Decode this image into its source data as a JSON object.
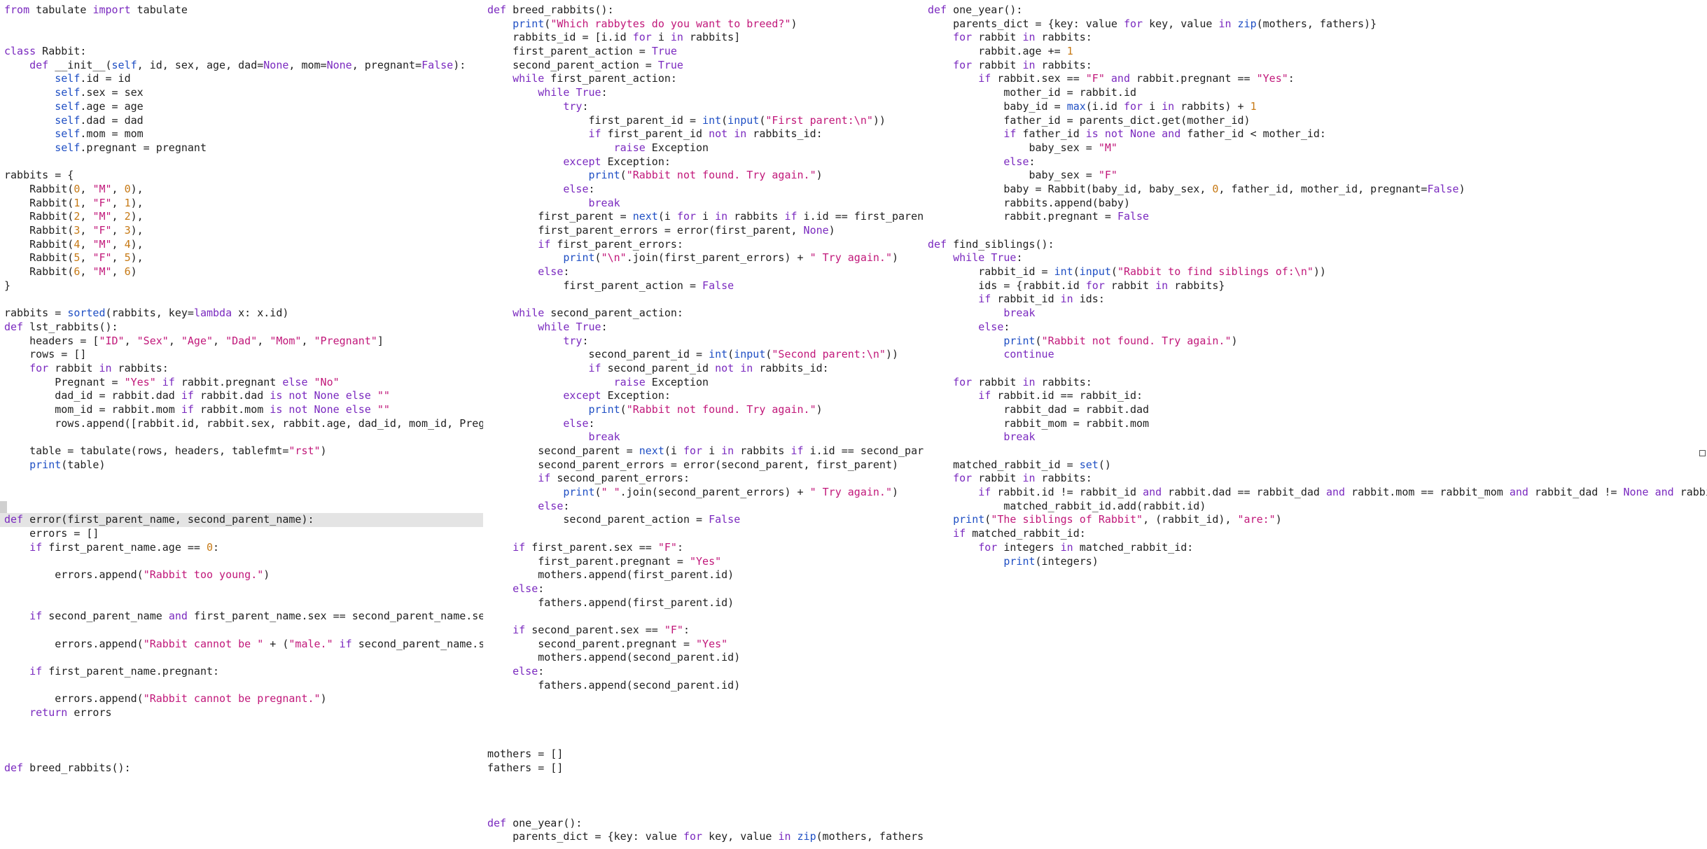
{
  "editor": {
    "highlighted_line": "def error(first_parent_name, second_parent_name):",
    "colors": {
      "keyword": "#7a29bf",
      "builtin": "#1f4fc4",
      "string": "#c1187a",
      "number": "#c77a16",
      "text": "#1f1f1f",
      "highlight": "#e4e4e4"
    },
    "panes": [
      {
        "id": "left",
        "lines": [
          "from tabulate import tabulate",
          "",
          "",
          "class Rabbit:",
          "    def __init__(self, id, sex, age, dad=None, mom=None, pregnant=False):",
          "        self.id = id",
          "        self.sex = sex",
          "        self.age = age",
          "        self.dad = dad",
          "        self.mom = mom",
          "        self.pregnant = pregnant",
          "",
          "rabbits = {",
          "    Rabbit(0, \"M\", 0),",
          "    Rabbit(1, \"F\", 1),",
          "    Rabbit(2, \"M\", 2),",
          "    Rabbit(3, \"F\", 3),",
          "    Rabbit(4, \"M\", 4),",
          "    Rabbit(5, \"F\", 5),",
          "    Rabbit(6, \"M\", 6)",
          "}",
          "",
          "rabbits = sorted(rabbits, key=lambda x: x.id)",
          "def lst_rabbits():",
          "    headers = [\"ID\", \"Sex\", \"Age\", \"Dad\", \"Mom\", \"Pregnant\"]",
          "    rows = []",
          "    for rabbit in rabbits:",
          "        Pregnant = \"Yes\" if rabbit.pregnant else \"No\"",
          "        dad_id = rabbit.dad if rabbit.dad is not None else \"\"",
          "        mom_id = rabbit.mom if rabbit.mom is not None else \"\"",
          "        rows.append([rabbit.id, rabbit.sex, rabbit.age, dad_id, mom_id, Pregnant])",
          "",
          "    table = tabulate(rows, headers, tablefmt=\"rst\")",
          "    print(table)",
          "",
          "",
          "",
          "def error(first_parent_name, second_parent_name):",
          "    errors = []",
          "    if first_parent_name.age == 0:",
          "",
          "        errors.append(\"Rabbit too young.\")",
          "",
          "",
          "    if second_parent_name and first_parent_name.sex == second_parent_name.sex:",
          "",
          "        errors.append(\"Rabbit cannot be \" + (\"male.\" if second_parent_name.sex ==",
          "",
          "    if first_parent_name.pregnant:",
          "",
          "        errors.append(\"Rabbit cannot be pregnant.\")",
          "    return errors",
          "",
          "",
          "",
          "def breed_rabbits():"
        ]
      },
      {
        "id": "mid",
        "lines": [
          "def breed_rabbits():",
          "    print(\"Which rabbytes do you want to breed?\")",
          "    rabbits_id = [i.id for i in rabbits]",
          "    first_parent_action = True",
          "    second_parent_action = True",
          "    while first_parent_action:",
          "        while True:",
          "            try:",
          "                first_parent_id = int(input(\"First parent:\\n\"))",
          "                if first_parent_id not in rabbits_id:",
          "                    raise Exception",
          "            except Exception:",
          "                print(\"Rabbit not found. Try again.\")",
          "            else:",
          "                break",
          "        first_parent = next(i for i in rabbits if i.id == first_parent_id)",
          "        first_parent_errors = error(first_parent, None)",
          "        if first_parent_errors:",
          "            print(\"\\n\".join(first_parent_errors) + \" Try again.\")",
          "        else:",
          "            first_parent_action = False",
          "",
          "    while second_parent_action:",
          "        while True:",
          "            try:",
          "                second_parent_id = int(input(\"Second parent:\\n\"))",
          "                if second_parent_id not in rabbits_id:",
          "                    raise Exception",
          "            except Exception:",
          "                print(\"Rabbit not found. Try again.\")",
          "            else:",
          "                break",
          "        second_parent = next(i for i in rabbits if i.id == second_parent_i",
          "        second_parent_errors = error(second_parent, first_parent)",
          "        if second_parent_errors:",
          "            print(\" \".join(second_parent_errors) + \" Try again.\")",
          "        else:",
          "            second_parent_action = False",
          "",
          "    if first_parent.sex == \"F\":",
          "        first_parent.pregnant = \"Yes\"",
          "        mothers.append(first_parent.id)",
          "    else:",
          "        fathers.append(first_parent.id)",
          "",
          "    if second_parent.sex == \"F\":",
          "        second_parent.pregnant = \"Yes\"",
          "        mothers.append(second_parent.id)",
          "    else:",
          "        fathers.append(second_parent.id)",
          "",
          "",
          "",
          "",
          "mothers = []",
          "fathers = []",
          "",
          "",
          "",
          "def one_year():",
          "    parents_dict = {key: value for key, value in zip(mothers, fathers)}"
        ]
      },
      {
        "id": "right",
        "lines": [
          "def one_year():",
          "    parents_dict = {key: value for key, value in zip(mothers, fathers)}",
          "    for rabbit in rabbits:",
          "        rabbit.age += 1",
          "    for rabbit in rabbits:",
          "        if rabbit.sex == \"F\" and rabbit.pregnant == \"Yes\":",
          "            mother_id = rabbit.id",
          "            baby_id = max(i.id for i in rabbits) + 1",
          "            father_id = parents_dict.get(mother_id)",
          "            if father_id is not None and father_id < mother_id:",
          "                baby_sex = \"M\"",
          "            else:",
          "                baby_sex = \"F\"",
          "            baby = Rabbit(baby_id, baby_sex, 0, father_id, mother_id, pregnant=False)",
          "            rabbits.append(baby)",
          "            rabbit.pregnant = False",
          "",
          "def find_siblings():",
          "    while True:",
          "        rabbit_id = int(input(\"Rabbit to find siblings of:\\n\"))",
          "        ids = {rabbit.id for rabbit in rabbits}",
          "        if rabbit_id in ids:",
          "            break",
          "        else:",
          "            print(\"Rabbit not found. Try again.\")",
          "            continue",
          "",
          "    for rabbit in rabbits:",
          "        if rabbit.id == rabbit_id:",
          "            rabbit_dad = rabbit.dad",
          "            rabbit_mom = rabbit.mom",
          "            break",
          "",
          "    matched_rabbit_id = set()",
          "    for rabbit in rabbits:",
          "        if rabbit.id != rabbit_id and rabbit.dad == rabbit_dad and rabbit.mom == rabbit_mom and rabbit_dad != None and rabbit_mom !=",
          "            matched_rabbit_id.add(rabbit.id)",
          "    print(\"The siblings of Rabbit\", (rabbit_id), \"are:\")",
          "    if matched_rabbit_id:",
          "        for integers in matched_rabbit_id:",
          "            print(integers)"
        ]
      }
    ]
  }
}
